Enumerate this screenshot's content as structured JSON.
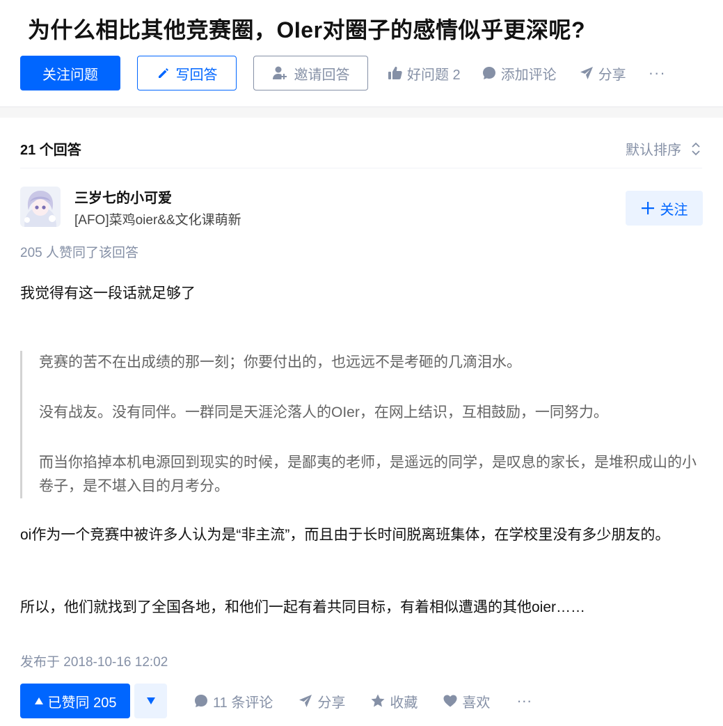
{
  "question": {
    "title": "为什么相比其他竞赛圈，OIer对圈子的感情似乎更深呢?",
    "follow_label": "关注问题",
    "write_label": "写回答",
    "invite_label": "邀请回答",
    "good_question_label": "好问题 2",
    "comment_label": "添加评论",
    "share_label": "分享",
    "more_label": "···"
  },
  "answers": {
    "count_label": "21 个回答",
    "sort_label": "默认排序"
  },
  "answer": {
    "author_name": "三岁七的小可爱",
    "author_bio": "[AFO]菜鸡oier&&文化课萌新",
    "follow_label": "关注",
    "votes_text": "205 人赞同了该回答",
    "paragraphs": {
      "p1": "我觉得有这一段话就足够了",
      "p2": "oi作为一个竞赛中被许多人认为是“非主流”，而且由于长时间脱离班集体，在学校里没有多少朋友的。",
      "p3": "所以，他们就找到了全国各地，和他们一起有着共同目标，有着相似遭遇的其他oier……"
    },
    "quote": [
      "竞赛的苦不在出成绩的那一刻；你要付出的，也远远不是考砸的几滴泪水。",
      "没有战友。没有同伴。一群同是天涯沦落人的OIer，在网上结识，互相鼓励，一同努力。",
      "而当你掐掉本机电源回到现实的时候，是鄙夷的老师，是遥远的同学，是叹息的家长，是堆积成山的小卷子，是不堪入目的月考分。"
    ],
    "published": "发布于 2018-10-16 12:02",
    "upvote_label": "已赞同 205",
    "comments_label": "11 条评论",
    "share_label": "分享",
    "collect_label": "收藏",
    "like_label": "喜欢",
    "more_label": "···"
  },
  "colors": {
    "primary": "#0066ff",
    "muted": "#8590a6",
    "light_blue_bg": "#ebf3ff"
  }
}
